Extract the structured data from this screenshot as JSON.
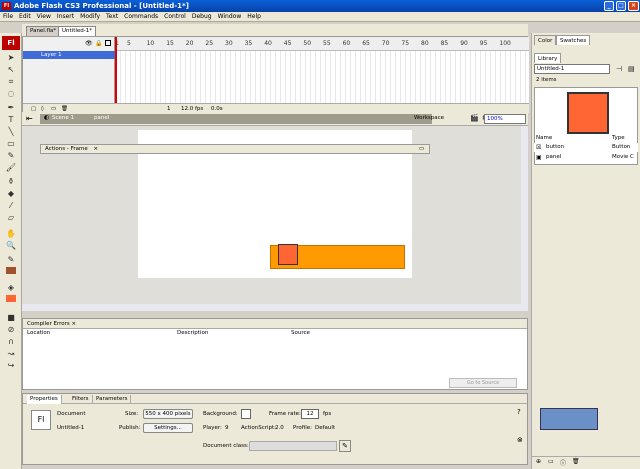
{
  "window": {
    "title": "Adobe Flash CS3 Professional - [Untitled-1*]",
    "app_icon": "Fl"
  },
  "menu": [
    "File",
    "Edit",
    "View",
    "Insert",
    "Modify",
    "Text",
    "Commands",
    "Control",
    "Debug",
    "Window",
    "Help"
  ],
  "doc_tabs": [
    "Panel.fla*",
    "Untitled-1*"
  ],
  "timeline": {
    "layer": "Layer 1",
    "ruler": [
      "1",
      "5",
      "10",
      "15",
      "20",
      "25",
      "30",
      "35",
      "40",
      "45",
      "50",
      "55",
      "60",
      "65",
      "70",
      "75",
      "80",
      "85",
      "90",
      "95",
      "100"
    ],
    "frame": "1",
    "fps": "12.0 fps",
    "time": "0.0s"
  },
  "scenebar": {
    "scene": "Scene 1",
    "symbol": "panel",
    "workspace": "Workspace",
    "zoom": "100%"
  },
  "actions_panel": {
    "title": "Actions - Frame"
  },
  "compiler": {
    "title": "Compiler Errors",
    "columns": [
      "Location",
      "Description",
      "Source"
    ],
    "goto": "Go to Source"
  },
  "properties": {
    "tabs": [
      "Properties",
      "Filters",
      "Parameters"
    ],
    "type_label": "Document",
    "doc_name": "Untitled-1",
    "icon_text": "Fl",
    "size_label": "Size:",
    "size_value": "550 x 400 pixels",
    "publish_label": "Publish:",
    "settings_btn": "Settings...",
    "background_label": "Background:",
    "framerate_label": "Frame rate:",
    "framerate_value": "12",
    "fps_unit": "fps",
    "player_label": "Player:",
    "player_value": "9",
    "as_label": "ActionScript:",
    "as_value": "2.0",
    "profile_label": "Profile:",
    "profile_value": "Default",
    "docclass_label": "Document class:"
  },
  "right": {
    "tabs": [
      "Color",
      "Swatches"
    ],
    "library_tab": "Library",
    "library_doc": "Untitled-1",
    "item_count": "2 items",
    "col_name": "Name",
    "col_type": "Type",
    "items": [
      {
        "name": "button",
        "type": "Button"
      },
      {
        "name": "panel",
        "type": "Movie C"
      }
    ]
  },
  "colors": {
    "orange": "#ff9a00",
    "red_square": "#ff6633",
    "title_blue": "#0a5fd8"
  }
}
